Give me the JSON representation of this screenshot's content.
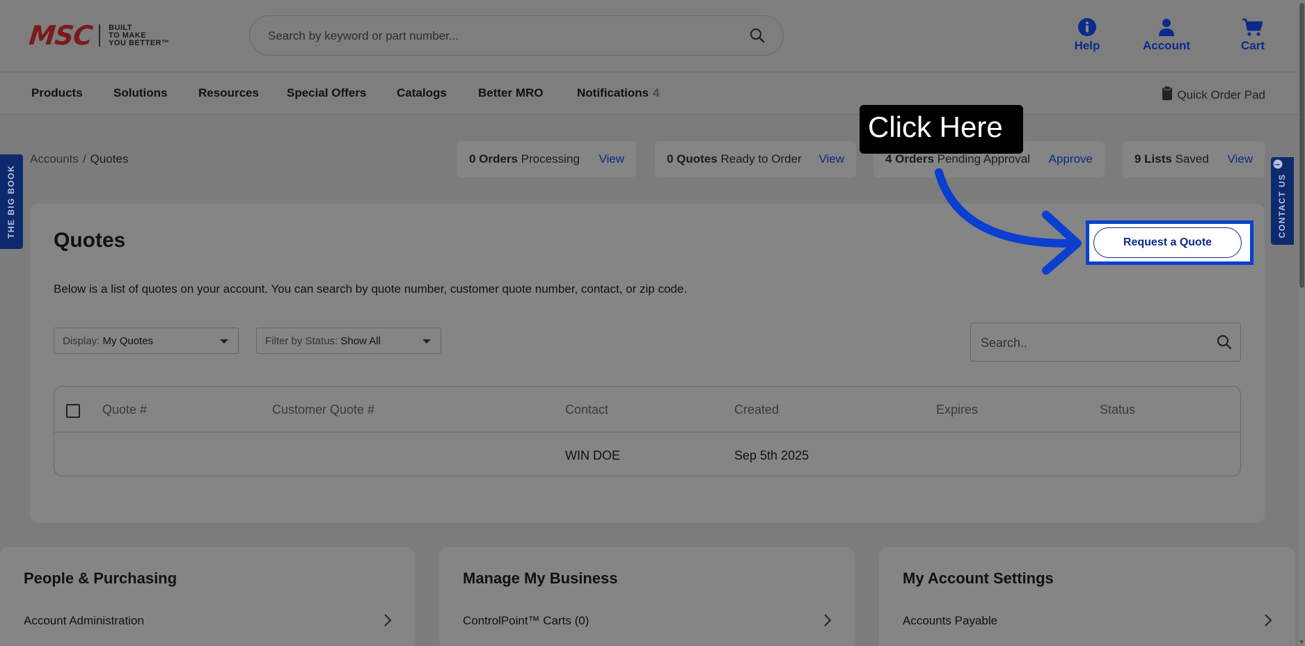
{
  "brand": {
    "name": "MSC",
    "tagline_1": "BUILT",
    "tagline_2": "TO MAKE",
    "tagline_3": "YOU BETTER",
    "trademark": "™",
    "color": "#7a1a1c"
  },
  "search": {
    "placeholder": "Search by keyword or part number..."
  },
  "header_actions": [
    {
      "label": "Help",
      "icon": "info-icon"
    },
    {
      "label": "Account",
      "icon": "user-icon"
    },
    {
      "label": "Cart",
      "icon": "cart-icon"
    }
  ],
  "nav": {
    "items": [
      "Products",
      "Solutions",
      "Resources",
      "Special Offers",
      "Catalogs",
      "Better MRO",
      "Notifications"
    ],
    "notifications_count": "4",
    "quick_order": "Quick Order Pad"
  },
  "side_tabs": {
    "left": "THE BIG BOOK",
    "right": "CONTACT US"
  },
  "breadcrumb": {
    "parent": "Accounts",
    "separator": "/",
    "current": "Quotes"
  },
  "stats": [
    {
      "bold": "0 Orders",
      "text": "Processing",
      "action": "View"
    },
    {
      "bold": "0 Quotes",
      "text": "Ready to Order",
      "action": "View"
    },
    {
      "bold": "4 Orders",
      "text": "Pending Approval",
      "action": "Approve"
    },
    {
      "bold": "9 Lists",
      "text": "Saved",
      "action": "View"
    }
  ],
  "callout": {
    "text": "Click Here"
  },
  "quotes": {
    "title": "Quotes",
    "description": "Below is a list of quotes on your account. You can search by quote number, customer quote number, contact, or zip code.",
    "request_button": "Request a Quote",
    "display_label": "Display:",
    "display_value": "My Quotes",
    "filter_label": "Filter by Status:",
    "filter_value": "Show All",
    "search_placeholder": "Search.."
  },
  "table": {
    "columns": [
      "Quote #",
      "Customer Quote #",
      "Contact",
      "Created",
      "Expires",
      "Status"
    ],
    "rows": [
      {
        "quote": "",
        "customer_quote": "",
        "contact": "WIN DOE",
        "created": "Sep 5th 2025",
        "expires": "",
        "status": ""
      }
    ]
  },
  "cards": [
    {
      "title": "People & Purchasing",
      "link": "Account Administration"
    },
    {
      "title": "Manage My Business",
      "link": "ControlPoint™ Carts (0)"
    },
    {
      "title": "My Account Settings",
      "link": "Accounts Payable"
    }
  ],
  "colors": {
    "accent": "#0b2a8a",
    "highlight": "#0b3fd0",
    "overlay": "#7e7e7e"
  }
}
